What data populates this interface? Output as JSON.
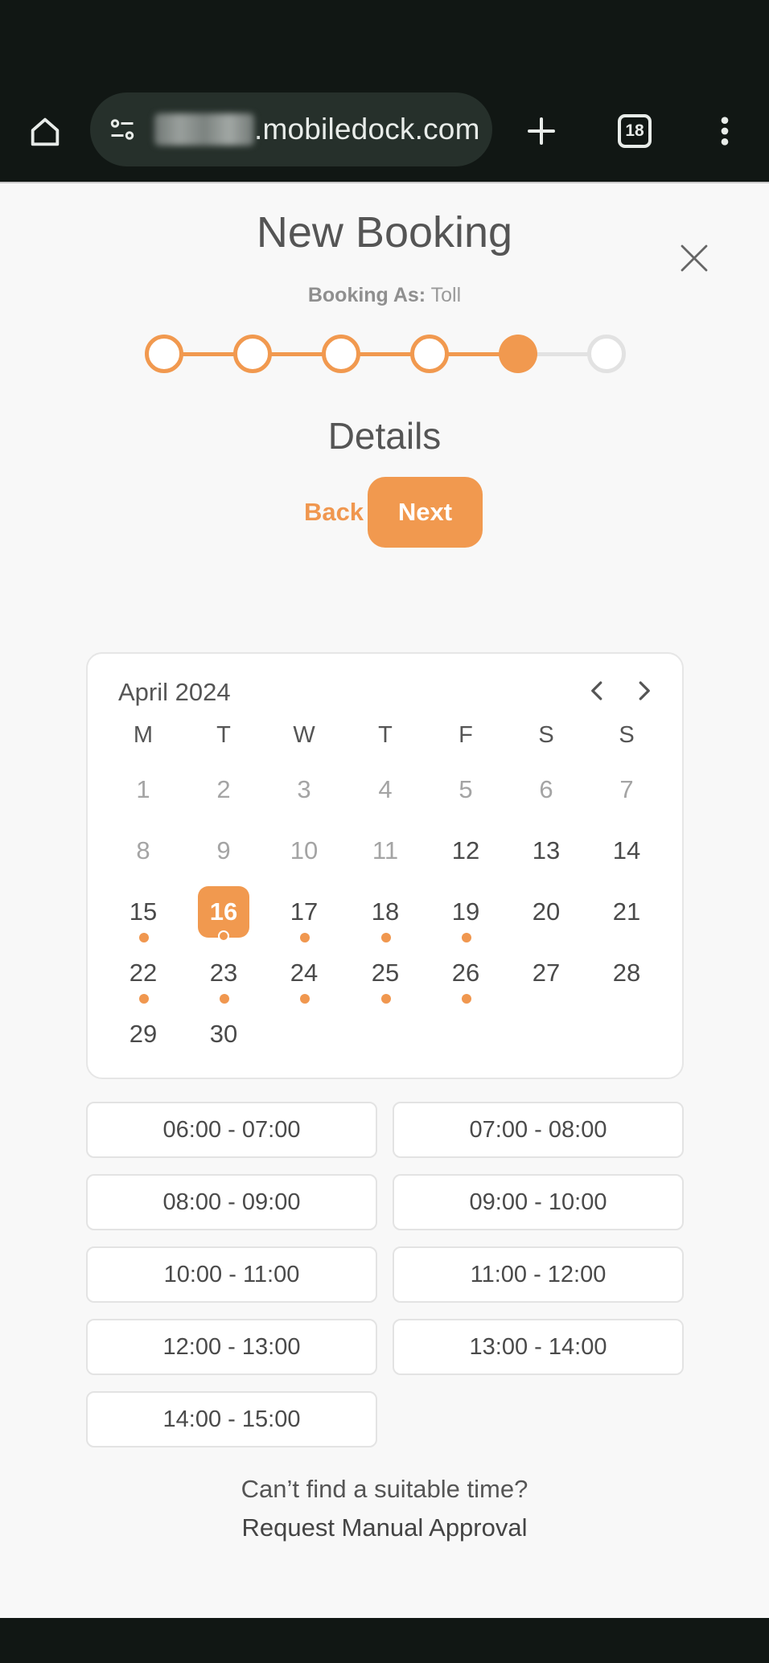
{
  "browser": {
    "url_domain": ".mobiledock.com",
    "tab_count": "18"
  },
  "page": {
    "title": "New Booking",
    "booking_as_label": "Booking As:",
    "booking_as_value": "Toll",
    "section_title": "Details",
    "back_label": "Back",
    "next_label": "Next",
    "accent_color": "#f1994f"
  },
  "stepper": {
    "total_steps": 6,
    "current_step": 5
  },
  "calendar": {
    "month_label": "April 2024",
    "weekdays": [
      "M",
      "T",
      "W",
      "T",
      "F",
      "S",
      "S"
    ],
    "weeks": [
      [
        "1",
        "2",
        "3",
        "4",
        "5",
        "6",
        "7"
      ],
      [
        "8",
        "9",
        "10",
        "11",
        "12",
        "13",
        "14"
      ],
      [
        "15",
        "16",
        "17",
        "18",
        "19",
        "20",
        "21"
      ],
      [
        "22",
        "23",
        "24",
        "25",
        "26",
        "27",
        "28"
      ],
      [
        "29",
        "30",
        "",
        "",
        "",
        "",
        ""
      ]
    ],
    "disabled_days": [
      "1",
      "2",
      "3",
      "4",
      "5",
      "6",
      "7",
      "8",
      "9",
      "10",
      "11"
    ],
    "selected_day": "16",
    "days_with_availability": [
      "15",
      "16",
      "17",
      "18",
      "19",
      "22",
      "23",
      "24",
      "25",
      "26"
    ]
  },
  "time_slots": [
    "06:00 - 07:00",
    "07:00 - 08:00",
    "08:00 - 09:00",
    "09:00 - 10:00",
    "10:00 - 11:00",
    "11:00 - 12:00",
    "12:00 - 13:00",
    "13:00 - 14:00",
    "14:00 - 15:00"
  ],
  "footer": {
    "cant_find_text": "Can’t find a suitable time?",
    "request_link": "Request Manual Approval"
  }
}
